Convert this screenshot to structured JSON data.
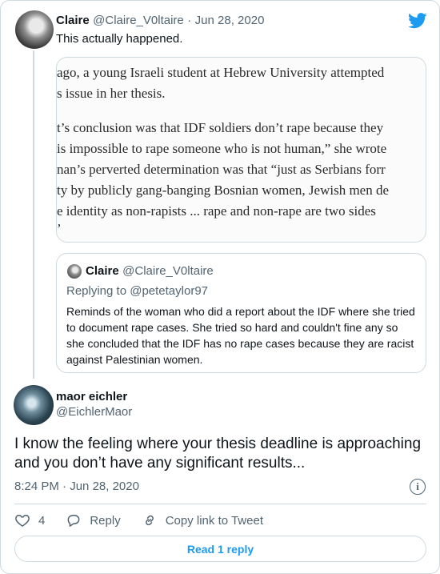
{
  "quoted_tweet": {
    "name": "Claire",
    "handle": "@Claire_V0ltaire",
    "separator": "·",
    "date": "Jun 28, 2020",
    "text": "This actually happened.",
    "media_lines": [
      "ago, a young Israeli student at Hebrew University attempted",
      "s issue in her thesis.",
      "t’s conclusion was that IDF soldiers don’t rape because they",
      "is impossible to rape someone who is not human,” she wrote",
      "nan’s perverted determination was that “just as Serbians forr",
      "ty by publicly gang-banging Bosnian women, Jewish men de",
      "e identity as non-rapists ... rape and non-rape are two sides",
      "’"
    ],
    "nested_quote": {
      "name": "Claire",
      "handle": "@Claire_V0ltaire",
      "replying_to_label": "Replying to",
      "replying_to_handle": "@petetaylor97",
      "text": "Reminds of the woman who did a report about the IDF where she tried to document rape cases. She tried so hard and couldn't fine any so she concluded that the IDF has no rape cases because they are racist against Palestinian women."
    }
  },
  "main_tweet": {
    "name": "maor eichler",
    "handle": "@EichlerMaor",
    "text": "I know the feeling where your thesis deadline is approaching and you don’t have any significant results...",
    "time": "8:24 PM",
    "separator": "·",
    "date": "Jun 28, 2020",
    "info_icon": "i",
    "likes": "4",
    "reply_label": "Reply",
    "copy_link_label": "Copy link to Tweet",
    "read_replies_label": "Read 1 reply"
  },
  "icons": {
    "brand": "twitter-bird-icon",
    "like": "heart-icon",
    "reply": "speech-bubble-icon",
    "link": "link-icon",
    "info": "info-icon"
  },
  "colors": {
    "accent": "#1d9bf0",
    "secondary_text": "#536471",
    "border": "#cfd9de"
  }
}
